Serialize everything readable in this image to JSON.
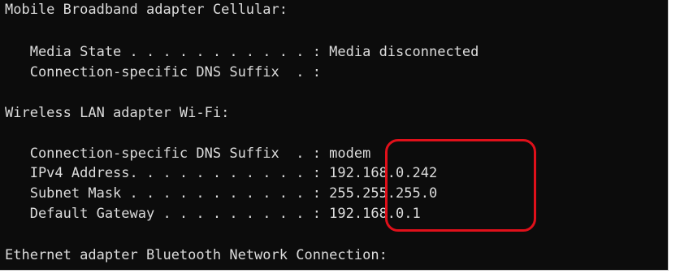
{
  "console": {
    "lines": [
      "Mobile Broadband adapter Cellular:",
      "",
      "   Media State . . . . . . . . . . . : Media disconnected",
      "   Connection-specific DNS Suffix  . :",
      "",
      "Wireless LAN adapter Wi-Fi:",
      "",
      "   Connection-specific DNS Suffix  . : modem",
      "   IPv4 Address. . . . . . . . . . . : 192.168.0.242",
      "   Subnet Mask . . . . . . . . . . . : 255.255.255.0",
      "   Default Gateway . . . . . . . . . : 192.168.0.1",
      "",
      "Ethernet adapter Bluetooth Network Connection:"
    ]
  },
  "colors": {
    "background": "#0c0c0c",
    "text": "#dcdcdc",
    "highlight": "#e0101a"
  }
}
